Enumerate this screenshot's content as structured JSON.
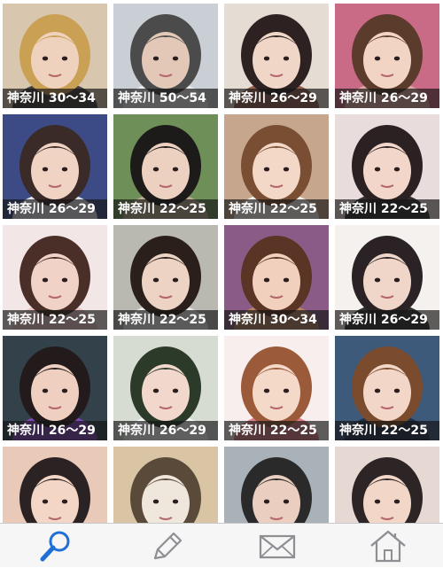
{
  "profiles": [
    {
      "label": "神奈川 30～34",
      "bg": "#d8c7ae",
      "skin": "#efd2bd",
      "hair": "#caa055",
      "accent": "#2a2a2a"
    },
    {
      "label": "神奈川 50～54",
      "bg": "#c9cfd4",
      "skin": "#e3c8b7",
      "hair": "#4b4b4b",
      "accent": "#f2f2f2"
    },
    {
      "label": "神奈川 26～29",
      "bg": "#e5dcd4",
      "skin": "#f0d6c6",
      "hair": "#2d2221",
      "accent": "#8a4b3a"
    },
    {
      "label": "神奈川 26～29",
      "bg": "#c96a87",
      "skin": "#f2d4c4",
      "hair": "#5a3b2c",
      "accent": "#e0b3a6"
    },
    {
      "label": "神奈川 26～29",
      "bg": "#3c4b86",
      "skin": "#f1d3c3",
      "hair": "#3a2a28",
      "accent": "#ffffff"
    },
    {
      "label": "神奈川 22～25",
      "bg": "#6f8f58",
      "skin": "#ecd0c0",
      "hair": "#1d1a1a",
      "accent": "#c9b09a"
    },
    {
      "label": "神奈川 22～25",
      "bg": "#c6a68d",
      "skin": "#f3d8c8",
      "hair": "#7a4e33",
      "accent": "#ffffff"
    },
    {
      "label": "神奈川 22～25",
      "bg": "#e8dcdc",
      "skin": "#f2d6c9",
      "hair": "#2b2022",
      "accent": "#111111"
    },
    {
      "label": "神奈川 22～25",
      "bg": "#f3e6e6",
      "skin": "#f0d2c6",
      "hair": "#4a2f28",
      "accent": "#e9c1c1"
    },
    {
      "label": "神奈川 22～25",
      "bg": "#b9b9b2",
      "skin": "#ecd3c3",
      "hair": "#2a1f1b",
      "accent": "#f6f6f6"
    },
    {
      "label": "神奈川 30～34",
      "bg": "#8a5b86",
      "skin": "#f1d1be",
      "hair": "#5a3424",
      "accent": "#c08a5f"
    },
    {
      "label": "神奈川 26～29",
      "bg": "#f4f1ef",
      "skin": "#f0d6c9",
      "hair": "#2a2224",
      "accent": "#111111"
    },
    {
      "label": "神奈川 26～29",
      "bg": "#33414a",
      "skin": "#efd0c0",
      "hair": "#231b1b",
      "accent": "#8e4cc9"
    },
    {
      "label": "神奈川 26～29",
      "bg": "#d7dcd3",
      "skin": "#f2d8cc",
      "hair": "#2c3a2a",
      "accent": "#ffffff"
    },
    {
      "label": "神奈川 22～25",
      "bg": "#f8eeee",
      "skin": "#f4d8c8",
      "hair": "#9b5a3a",
      "accent": "#d96b78"
    },
    {
      "label": "神奈川 22～25",
      "bg": "#3e5a7a",
      "skin": "#f2d6c8",
      "hair": "#7a4b2d",
      "accent": "#1c2a44"
    },
    {
      "label": "",
      "bg": "#e9c9b7",
      "skin": "#f3d6c6",
      "hair": "#2b2224",
      "accent": "#3b6ac9"
    },
    {
      "label": "",
      "bg": "#d9c4a3",
      "skin": "#efe7dc",
      "hair": "#5a4a3a",
      "accent": "#b3a48a"
    },
    {
      "label": "",
      "bg": "#a9b2b8",
      "skin": "#eacfc0",
      "hair": "#2a2a2a",
      "accent": "#6f7d86"
    },
    {
      "label": "",
      "bg": "#e6d8d2",
      "skin": "#f2d6c8",
      "hair": "#2d2426",
      "accent": "#b36bd6"
    }
  ],
  "tabbar": {
    "accent": "#1f6fd6",
    "inactive": "#8e8e93",
    "items": [
      {
        "icon": "search-icon",
        "active": true
      },
      {
        "icon": "pencil-icon",
        "active": false
      },
      {
        "icon": "envelope-icon",
        "active": false
      },
      {
        "icon": "home-icon",
        "active": false
      }
    ]
  }
}
